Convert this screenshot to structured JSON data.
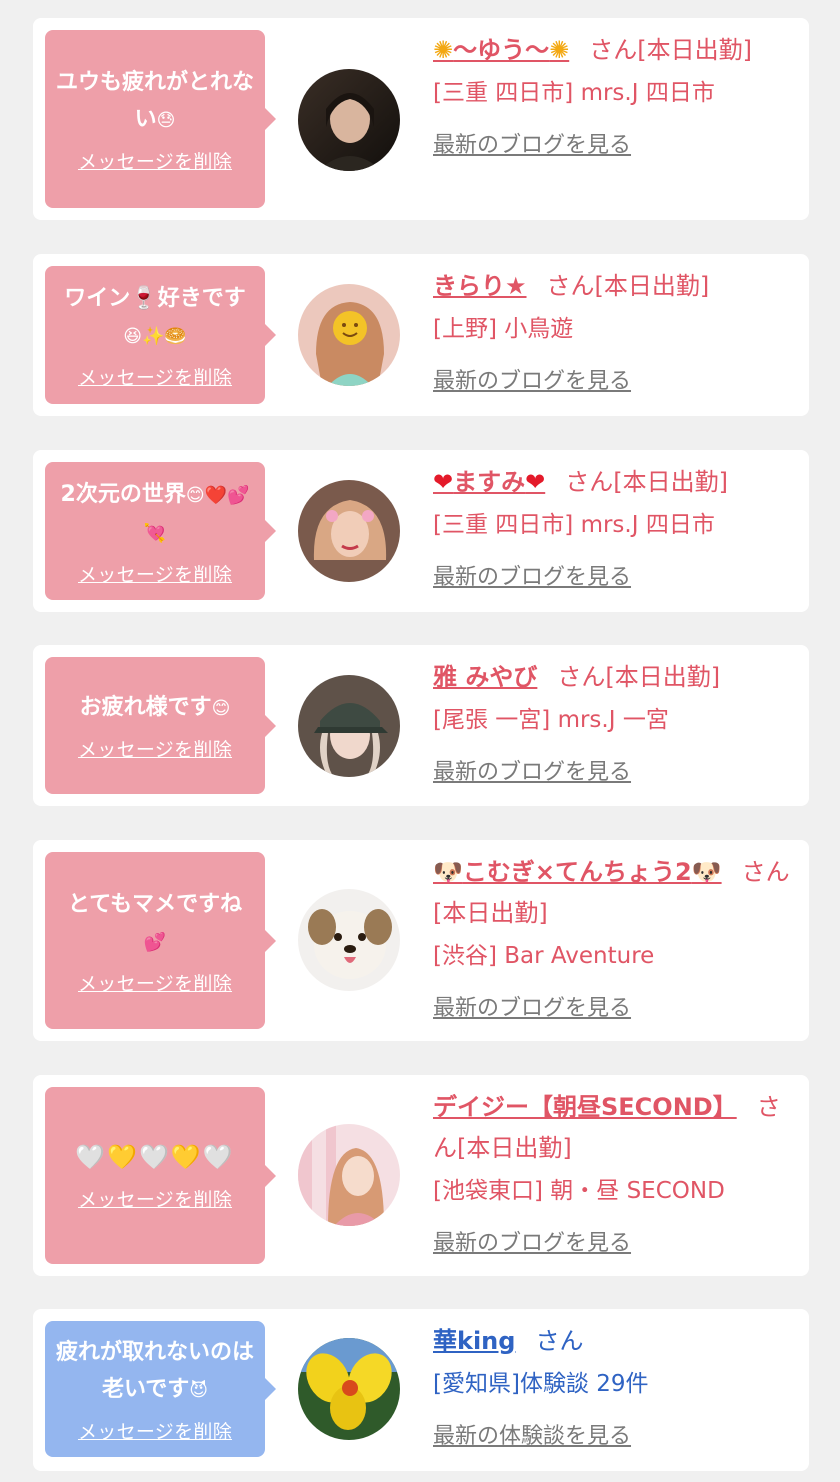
{
  "actions": {
    "delete_label": "メッセージを削除",
    "blog_label": "最新のブログを見る",
    "review_label": "最新の体験談を見る",
    "san_suffix": "さん"
  },
  "messages": [
    {
      "message": "ユウも疲れがとれない",
      "message_emoji": "😓",
      "name": "〜ゆう〜",
      "name_icon": "sunflower-icon",
      "status": "[本日出勤]",
      "shop": "[三重 四日市] mrs.J 四日市"
    },
    {
      "message": "ワイン🍷好きです",
      "message_emoji": "😆✨🥯",
      "name": "きらり★",
      "status": "[本日出勤]",
      "shop": "[上野] 小鳥遊"
    },
    {
      "message": "2次元の世界",
      "message_emoji": "😊❤️💕💘",
      "name": "ますみ",
      "name_icon": "heart-icon",
      "status": "[本日出勤]",
      "shop": "[三重 四日市] mrs.J 四日市"
    },
    {
      "message": "お疲れ様です",
      "message_emoji": "😊",
      "name": "雅 みやび",
      "status": "[本日出勤]",
      "shop": "[尾張 一宮] mrs.J 一宮"
    },
    {
      "message": "とてもマメですね",
      "message_emoji": "💕",
      "name": "こむぎ×てんちょう2",
      "name_icon": "dog-face-icon",
      "status": "[本日出勤]",
      "shop": "[渋谷] Bar Aventure"
    },
    {
      "message": "",
      "message_emoji": "🤍💛🤍💛🤍",
      "name": "デイジー【朝昼SECOND】",
      "status": "[本日出勤]",
      "shop": "[池袋東口] 朝・昼 SECOND"
    },
    {
      "message": "疲れが取れないのは老いです",
      "message_emoji": "😈",
      "name": "華king",
      "status": "",
      "shop": "[愛知県]体験談 29件"
    }
  ],
  "colors": {
    "pink_bubble": "#ee9fa9",
    "blue_bubble": "#94b6ef",
    "accent_pink": "#e05565",
    "accent_blue": "#2f63c3",
    "link_gray": "#7a7a7a",
    "page_bg": "#f0f0f0"
  }
}
